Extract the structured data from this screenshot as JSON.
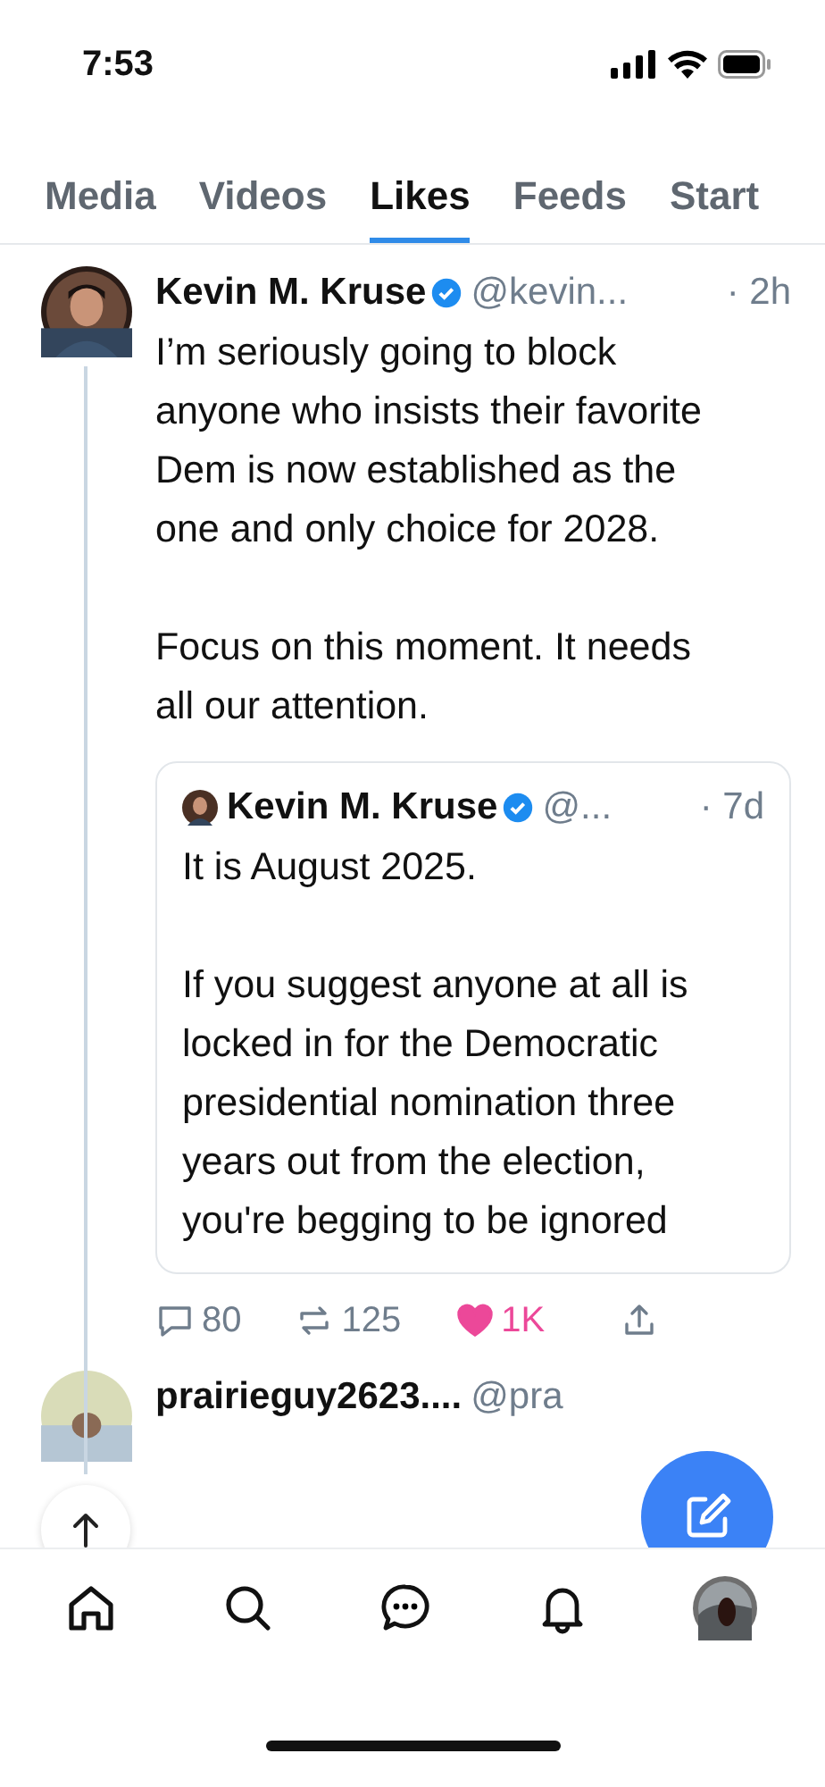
{
  "status_bar": {
    "time": "7:53"
  },
  "tabs": [
    {
      "label": "Media",
      "selected": false
    },
    {
      "label": "Videos",
      "selected": false
    },
    {
      "label": "Likes",
      "selected": true
    },
    {
      "label": "Feeds",
      "selected": false
    },
    {
      "label": "Start",
      "selected": false
    }
  ],
  "posts": [
    {
      "author": "Kevin M. Kruse",
      "verified": true,
      "handle": "@kevin...",
      "time": "· 2h",
      "text": "I’m seriously going to block anyone who insists their favorite Dem is now established as the one and only choice for 2028.\n\nFocus on this moment. It needs all our attention.",
      "quote": {
        "author": "Kevin M. Kruse",
        "verified": true,
        "handle": "@...",
        "time": "· 7d",
        "text": "It is August 2025.\n\nIf you suggest anyone at all is locked in for the Democratic presidential nomination three years out from the election, you're begging to be ignored"
      },
      "replies": "80",
      "reposts": "125",
      "likes": "1K",
      "liked": true
    },
    {
      "author": "prairieguy2623....",
      "verified": false,
      "handle": "@pra"
    }
  ]
}
